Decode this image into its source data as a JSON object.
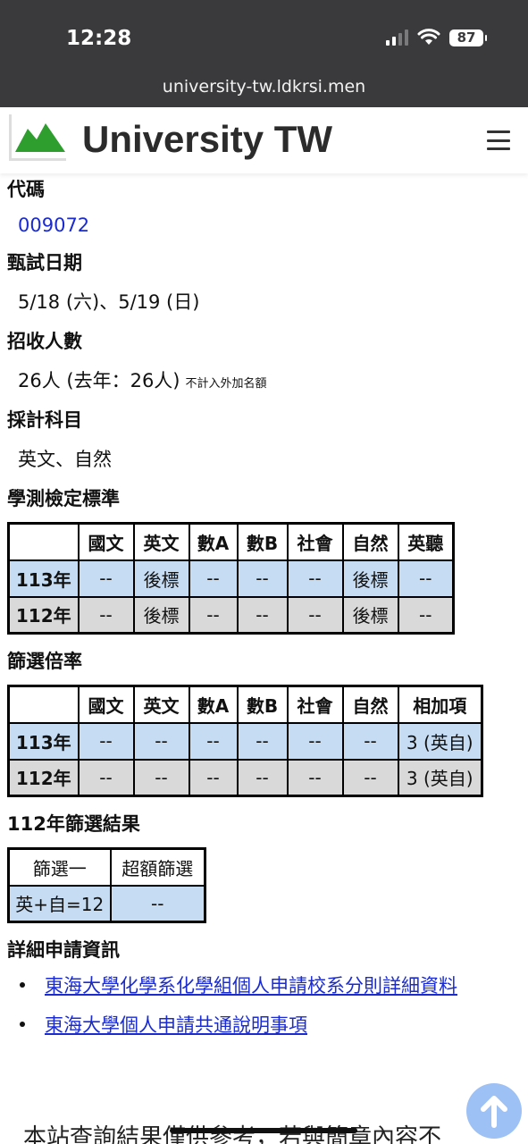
{
  "status_bar": {
    "time": "12:28",
    "battery": "87"
  },
  "browser": {
    "url": "university-tw.ldkrsi.men"
  },
  "header": {
    "site_title": "University TW"
  },
  "fields": {
    "code_label": "代碼",
    "code_value": "009072",
    "exam_date_label": "甄試日期",
    "exam_date_value": "5/18 (六)、5/19 (日)",
    "quota_label": "招收人數",
    "quota_value": "26人 (去年：26人)",
    "quota_note": "不計入外加名額",
    "subjects_label": "採計科目",
    "subjects_value": "英文、自然"
  },
  "standards": {
    "title": "學測檢定標準",
    "columns": [
      "",
      "國文",
      "英文",
      "數A",
      "數B",
      "社會",
      "自然",
      "英聽"
    ],
    "rows": [
      [
        "113年",
        "--",
        "後標",
        "--",
        "--",
        "--",
        "後標",
        "--"
      ],
      [
        "112年",
        "--",
        "後標",
        "--",
        "--",
        "--",
        "後標",
        "--"
      ]
    ]
  },
  "screening_ratio": {
    "title": "篩選倍率",
    "columns": [
      "",
      "國文",
      "英文",
      "數A",
      "數B",
      "社會",
      "自然",
      "相加項"
    ],
    "rows": [
      [
        "113年",
        "--",
        "--",
        "--",
        "--",
        "--",
        "--",
        "3 (英自)"
      ],
      [
        "112年",
        "--",
        "--",
        "--",
        "--",
        "--",
        "--",
        "3 (英自)"
      ]
    ]
  },
  "screening_result": {
    "title": "112年篩選結果",
    "columns": [
      "篩選一",
      "超額篩選"
    ],
    "row": [
      "英+自=12",
      "--"
    ]
  },
  "details": {
    "title": "詳細申請資訊",
    "links": [
      "東海大學化學系化學組個人申請校系分則詳細資料",
      "東海大學個人申請共通說明事項"
    ]
  },
  "footer_text": "本站查詢結果僅供參考，若與簡章內容不",
  "colors": {
    "link": "#1a2bd0",
    "row_blue": "#c6dcf3",
    "row_gray": "#d9d9d9",
    "logo_green": "#2e9e2e",
    "scroll_button": "#9ec1f5"
  },
  "icons": {
    "menu": "hamburger-icon",
    "scroll": "arrow-up-icon",
    "logo": "green-mountain-logo"
  }
}
